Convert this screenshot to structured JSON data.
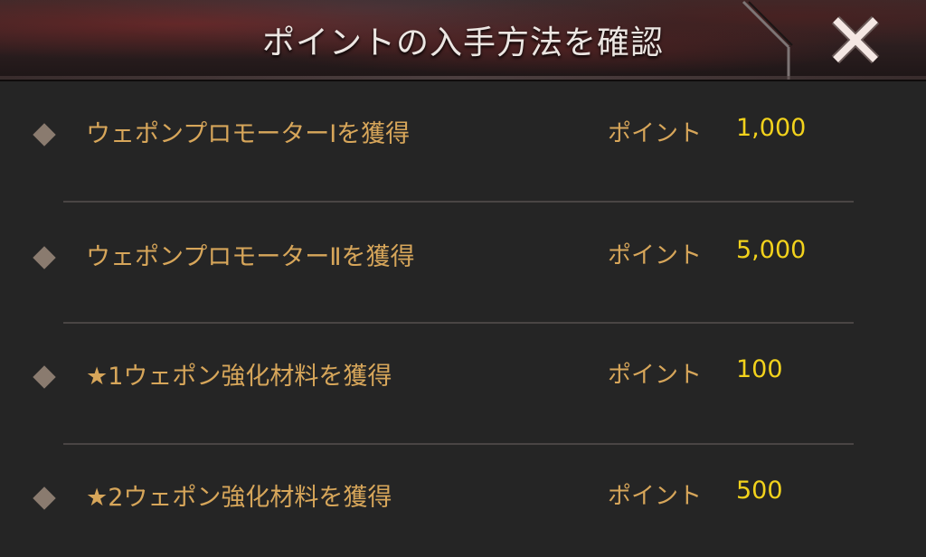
{
  "header": {
    "title": "ポイントの入手方法を確認",
    "close_icon": "close-icon",
    "accent_color": "#d7a65a",
    "value_color": "#f2d21c"
  },
  "rows": [
    {
      "label": "ウェポンプロモーターⅠを獲得",
      "points_label": "ポイント",
      "points": "1,000"
    },
    {
      "label": "ウェポンプロモーターⅡを獲得",
      "points_label": "ポイント",
      "points": "5,000"
    },
    {
      "label": "★1ウェポン強化材料を獲得",
      "points_label": "ポイント",
      "points": "100"
    },
    {
      "label": "★2ウェポン強化材料を獲得",
      "points_label": "ポイント",
      "points": "500"
    }
  ]
}
